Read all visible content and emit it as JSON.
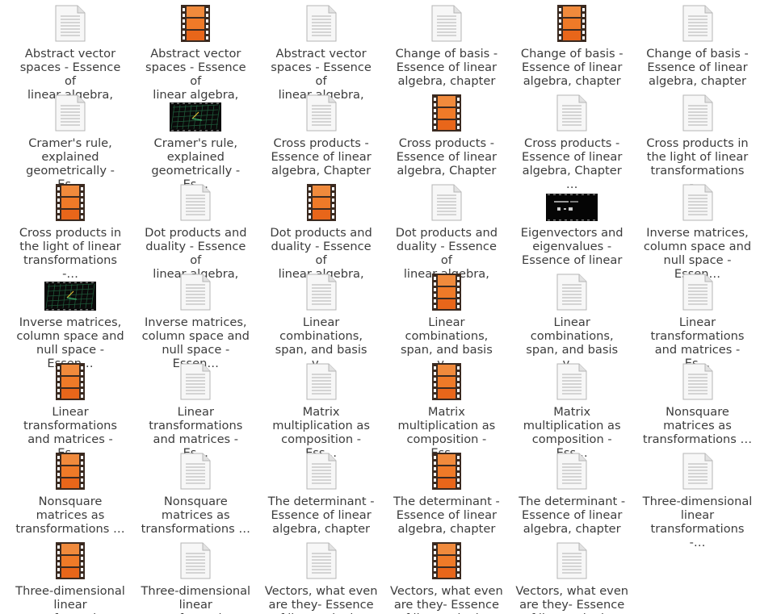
{
  "files": [
    {
      "icon": "document-icon",
      "label": "Abstract vector\nspaces - Essence of\nlinear algebra, ch…"
    },
    {
      "icon": "video-file-icon",
      "label": "Abstract vector\nspaces - Essence of\nlinear algebra, ch…"
    },
    {
      "icon": "document-icon",
      "label": "Abstract vector\nspaces - Essence of\nlinear algebra, ch…"
    },
    {
      "icon": "document-icon",
      "label": "Change of basis -\nEssence of linear\nalgebra, chapter …"
    },
    {
      "icon": "video-file-icon",
      "label": "Change of basis -\nEssence of linear\nalgebra, chapter …"
    },
    {
      "icon": "document-icon",
      "label": "Change of basis -\nEssence of linear\nalgebra, chapter …"
    },
    {
      "icon": "document-icon",
      "label": "Cramer's rule,\nexplained\ngeometrically - Es…"
    },
    {
      "icon": "video-thumbnail-grid-icon",
      "label": "Cramer's rule,\nexplained\ngeometrically - Es…"
    },
    {
      "icon": "document-icon",
      "label": "Cross products -\nEssence of linear\nalgebra, Chapter …"
    },
    {
      "icon": "video-file-icon",
      "label": "Cross products -\nEssence of linear\nalgebra, Chapter …"
    },
    {
      "icon": "document-icon",
      "label": "Cross products -\nEssence of linear\nalgebra, Chapter …"
    },
    {
      "icon": "document-icon",
      "label": "Cross products in\nthe light of linear\ntransformations -…"
    },
    {
      "icon": "video-file-icon",
      "label": "Cross products in\nthe light of linear\ntransformations -…"
    },
    {
      "icon": "document-icon",
      "label": "Dot products and\nduality - Essence of\nlinear algebra, ch…"
    },
    {
      "icon": "video-file-icon",
      "label": "Dot products and\nduality - Essence of\nlinear algebra, ch…"
    },
    {
      "icon": "document-icon",
      "label": "Dot products and\nduality - Essence of\nlinear algebra, ch…"
    },
    {
      "icon": "video-thumbnail-dark-icon",
      "label": "Eigenvectors and\neigenvalues -\nEssence of linear …"
    },
    {
      "icon": "document-icon",
      "label": "Inverse matrices,\ncolumn space and\nnull space - Essen…"
    },
    {
      "icon": "video-thumbnail-grid-icon",
      "label": "Inverse matrices,\ncolumn space and\nnull space - Essen…"
    },
    {
      "icon": "document-icon",
      "label": "Inverse matrices,\ncolumn space and\nnull space - Essen…"
    },
    {
      "icon": "document-icon",
      "label": "Linear\ncombinations,\nspan, and basis v…"
    },
    {
      "icon": "video-file-icon",
      "label": "Linear\ncombinations,\nspan, and basis v…"
    },
    {
      "icon": "document-icon",
      "label": "Linear\ncombinations,\nspan, and basis v…"
    },
    {
      "icon": "document-icon",
      "label": "Linear\ntransformations\nand matrices - Es…"
    },
    {
      "icon": "video-file-icon",
      "label": "Linear\ntransformations\nand matrices - Es…"
    },
    {
      "icon": "document-icon",
      "label": "Linear\ntransformations\nand matrices - Es…"
    },
    {
      "icon": "document-icon",
      "label": "Matrix\nmultiplication as\ncomposition - Ess…"
    },
    {
      "icon": "video-file-icon",
      "label": "Matrix\nmultiplication as\ncomposition - Ess…"
    },
    {
      "icon": "document-icon",
      "label": "Matrix\nmultiplication as\ncomposition - Ess…"
    },
    {
      "icon": "document-icon",
      "label": "Nonsquare\nmatrices as\ntransformations …"
    },
    {
      "icon": "video-file-icon",
      "label": "Nonsquare\nmatrices as\ntransformations …"
    },
    {
      "icon": "document-icon",
      "label": "Nonsquare\nmatrices as\ntransformations …"
    },
    {
      "icon": "document-icon",
      "label": "The determinant -\nEssence of linear\nalgebra, chapter …"
    },
    {
      "icon": "video-file-icon",
      "label": "The determinant -\nEssence of linear\nalgebra, chapter …"
    },
    {
      "icon": "document-icon",
      "label": "The determinant -\nEssence of linear\nalgebra, chapter …"
    },
    {
      "icon": "document-icon",
      "label": "Three-dimensional\nlinear\ntransformations -…"
    },
    {
      "icon": "video-file-icon",
      "label": "Three-dimensional\nlinear\ntransformations"
    },
    {
      "icon": "document-icon",
      "label": "Three-dimensional\nlinear\ntransformations"
    },
    {
      "icon": "document-icon",
      "label": "Vectors, what even\nare they- Essence\nof linear algebra"
    },
    {
      "icon": "video-file-icon",
      "label": "Vectors, what even\nare they- Essence\nof linear algebra"
    },
    {
      "icon": "document-icon",
      "label": "Vectors, what even\nare they- Essence\nof linear algebra"
    }
  ]
}
